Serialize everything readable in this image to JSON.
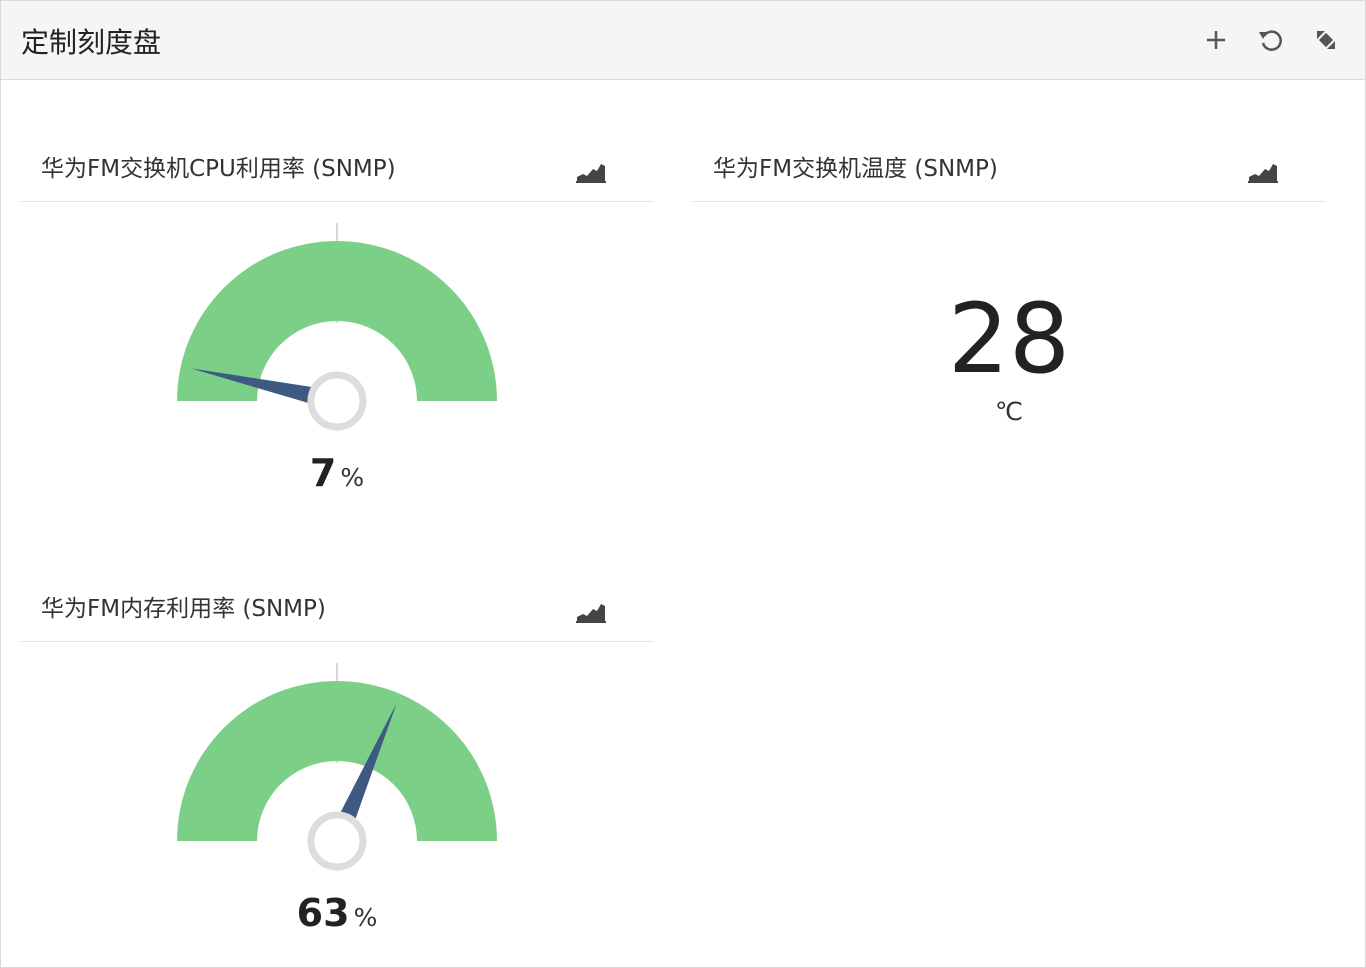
{
  "header": {
    "title": "定制刻度盘",
    "buttons": [
      {
        "name": "add",
        "icon": "plus-icon"
      },
      {
        "name": "refresh",
        "icon": "refresh-icon"
      },
      {
        "name": "collapse",
        "icon": "collapse-icon"
      }
    ]
  },
  "widgets": [
    {
      "id": "cpu",
      "title": "华为FM交换机CPU利用率 (SNMP)",
      "type": "gauge",
      "value": "7",
      "value_numeric": 7,
      "unit": "%",
      "min": 0,
      "max": 100,
      "icon": "area-chart-icon"
    },
    {
      "id": "temperature",
      "title": "华为FM交换机温度 (SNMP)",
      "type": "number",
      "value": "28",
      "unit": "℃",
      "icon": "area-chart-icon"
    },
    {
      "id": "memory",
      "title": "华为FM内存利用率 (SNMP)",
      "type": "gauge",
      "value": "63",
      "value_numeric": 63,
      "unit": "%",
      "min": 0,
      "max": 100,
      "icon": "area-chart-icon"
    }
  ],
  "colors": {
    "gauge_fill": "#7ccf86",
    "needle": "#3f5a82",
    "hub": "#dddddd",
    "tick": "#d8d8d8",
    "icon": "#444444",
    "header_bg": "#f5f5f5"
  }
}
